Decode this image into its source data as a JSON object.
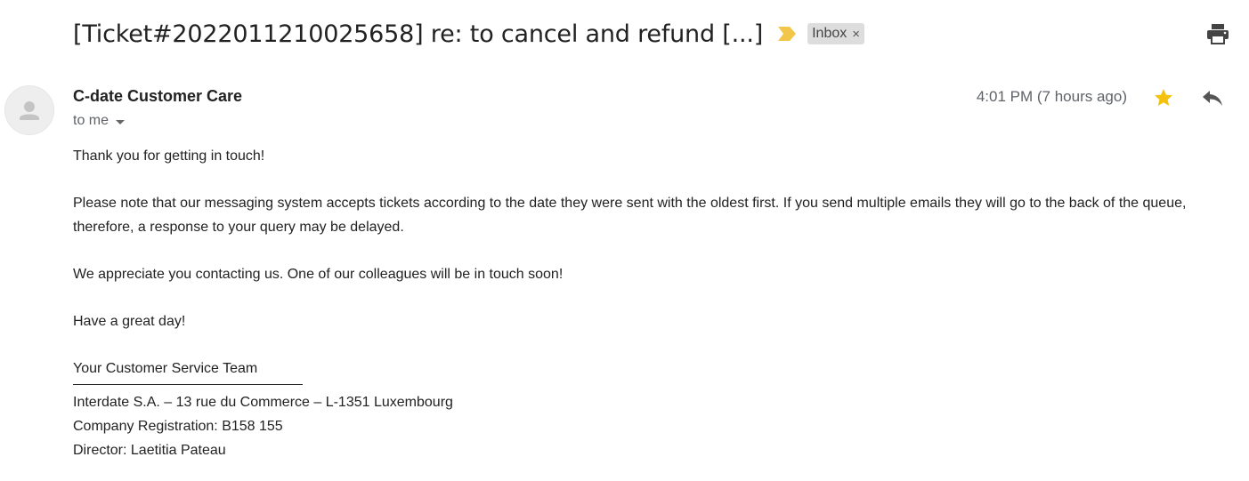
{
  "subject": "[Ticket#2022011210025658] re: to cancel and refund [...]",
  "label": {
    "name": "Inbox",
    "remove": "×"
  },
  "sender": {
    "name": "C-date Customer Care",
    "recipient": "to me"
  },
  "timestamp": "4:01 PM (7 hours ago)",
  "starred": true,
  "colors": {
    "star": "#f4c20d",
    "importance": "#f2c649",
    "chip_bg": "#dddddd"
  },
  "icons": [
    "importance-marker-icon",
    "print-icon",
    "avatar-person-icon",
    "star-icon",
    "reply-icon",
    "chevron-down-icon"
  ],
  "message": {
    "greeting": "Thank you for getting in touch!",
    "paragraph1": "Please note that our messaging system accepts tickets according to the date they were sent with the oldest first. If you send multiple emails they will go to the back of the queue, therefore, a response to your query may be delayed.",
    "paragraph2": "We appreciate you contacting us. One of our colleagues will be in touch soon!",
    "closing": "Have a great day!",
    "team": "Your Customer Service Team",
    "signature": {
      "address": "Interdate S.A. – 13 rue du Commerce  – L-1351 Luxembourg",
      "registration": "Company Registration: B158 155",
      "director": "Director: Laetitia Pateau"
    }
  }
}
